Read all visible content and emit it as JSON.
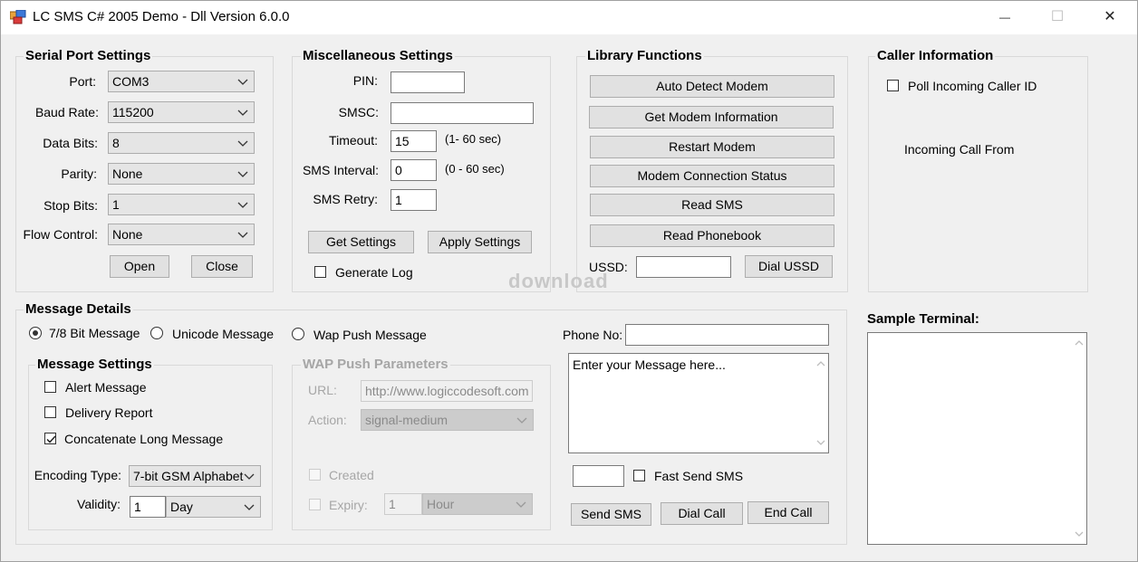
{
  "window": {
    "title": "LC SMS C# 2005 Demo - Dll Version 6.0.0",
    "minimize_glyph": "—",
    "maximize_glyph": "☐",
    "close_glyph": "✕"
  },
  "serial": {
    "title": "Serial Port Settings",
    "port_label": "Port:",
    "port_value": "COM3",
    "baud_label": "Baud Rate:",
    "baud_value": "115200",
    "databits_label": "Data Bits:",
    "databits_value": "8",
    "parity_label": "Parity:",
    "parity_value": "None",
    "stopbits_label": "Stop Bits:",
    "stopbits_value": "1",
    "flow_label": "Flow Control:",
    "flow_value": "None",
    "open_label": "Open",
    "close_label": "Close"
  },
  "misc": {
    "title": "Miscellaneous Settings",
    "pin_label": "PIN:",
    "pin_value": "",
    "smsc_label": "SMSC:",
    "smsc_value": "",
    "timeout_label": "Timeout:",
    "timeout_value": "15",
    "timeout_hint": "(1- 60 sec)",
    "interval_label": "SMS Interval:",
    "interval_value": "0",
    "interval_hint": "(0 - 60 sec)",
    "retry_label": "SMS Retry:",
    "retry_value": "1",
    "get_label": "Get Settings",
    "apply_label": "Apply Settings",
    "log_label": "Generate Log",
    "log_checked": false
  },
  "library": {
    "title": "Library Functions",
    "buttons": [
      "Auto Detect Modem",
      "Get Modem Information",
      "Restart Modem",
      "Modem Connection Status",
      "Read SMS",
      "Read Phonebook"
    ],
    "ussd_label": "USSD:",
    "ussd_value": "",
    "dial_ussd_label": "Dial USSD"
  },
  "caller": {
    "title": "Caller Information",
    "poll_label": "Poll Incoming Caller ID",
    "poll_checked": false,
    "incoming_label": "Incoming Call From"
  },
  "watermark": "download",
  "message": {
    "title": "Message Details",
    "radio_78": "7/8 Bit Message",
    "radio_unicode": "Unicode Message",
    "radio_wap": "Wap Push Message",
    "selected": "7/8 Bit Message",
    "phone_label": "Phone No:",
    "phone_value": "",
    "message_placeholder": "Enter your Message here...",
    "fast_value": "",
    "fast_label": "Fast Send SMS",
    "fast_checked": false,
    "send_label": "Send SMS",
    "dial_call_label": "Dial Call",
    "end_call_label": "End Call"
  },
  "msgsettings": {
    "title": "Message Settings",
    "alert_label": "Alert Message",
    "alert_checked": false,
    "delivery_label": "Delivery Report",
    "delivery_checked": false,
    "concat_label": "Concatenate Long Message",
    "concat_checked": true,
    "encoding_label": "Encoding Type:",
    "encoding_value": "7-bit GSM Alphabet",
    "validity_label": "Validity:",
    "validity_number": "1",
    "validity_unit": "Day"
  },
  "wap": {
    "title": "WAP Push Parameters",
    "url_label": "URL:",
    "url_value": "http://www.logiccodesoft.com",
    "action_label": "Action:",
    "action_value": "signal-medium",
    "created_label": "Created",
    "expiry_label": "Expiry:",
    "expiry_number": "1",
    "expiry_unit": "Hour"
  },
  "terminal": {
    "title": "Sample Terminal:"
  }
}
